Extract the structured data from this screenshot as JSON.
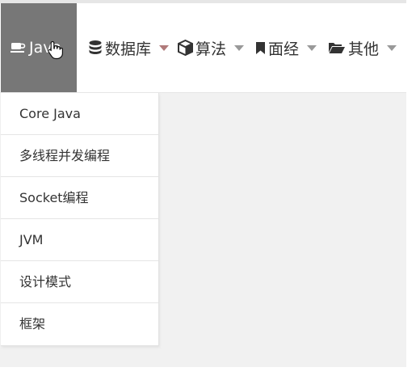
{
  "navbar": {
    "items": [
      {
        "label": "Java",
        "icon": "coffee-cup-icon"
      },
      {
        "label": "数据库",
        "icon": "database-icon"
      },
      {
        "label": "算法",
        "icon": "cube-icon"
      },
      {
        "label": "面经",
        "icon": "bookmark-icon"
      },
      {
        "label": "其他",
        "icon": "folder-open-icon"
      }
    ]
  },
  "dropdown": {
    "items": [
      {
        "label": "Core Java"
      },
      {
        "label": "多线程并发编程"
      },
      {
        "label": "Socket编程"
      },
      {
        "label": "JVM"
      },
      {
        "label": "设计模式"
      },
      {
        "label": "框架"
      }
    ]
  },
  "colors": {
    "active_bg": "#777777",
    "content_bg": "#f1f1f1",
    "text": "#333333"
  }
}
